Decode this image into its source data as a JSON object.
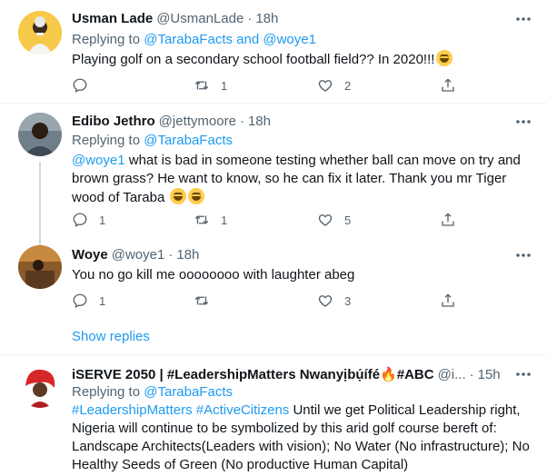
{
  "tweets": [
    {
      "name": "Usman Lade",
      "handle": "@UsmanLade",
      "dot": "·",
      "time": "18h",
      "replying_prefix": "Replying to",
      "replying_to_1": "@TarabaFacts",
      "replying_and": "and",
      "replying_to_2": "@woye1",
      "text": "Playing golf on a secondary school football field?? In 2020!!!",
      "emoji": "laughing-face",
      "reply_count": "",
      "retweet_count": "1",
      "like_count": "2"
    },
    {
      "name": "Edibo Jethro",
      "handle": "@jettymoore",
      "dot": "·",
      "time": "18h",
      "replying_prefix": "Replying to",
      "replying_to_1": "@TarabaFacts",
      "mention": "@woye1",
      "text": " what is bad in someone testing whether ball can move on try and brown grass? He want to know, so he can fix it later. Thank you mr Tiger wood of Taraba",
      "emoji": "grinning-face",
      "reply_count": "1",
      "retweet_count": "1",
      "like_count": "5"
    },
    {
      "name": "Woye",
      "handle": "@woye1",
      "dot": "·",
      "time": "18h",
      "text": "You no go kill me oooooooo with laughter abeg",
      "reply_count": "1",
      "retweet_count": "",
      "like_count": "3"
    },
    {
      "name": "iSERVE 2050 | #LeadershipMatters Nwanyịbụ́ífé🔥#ABC",
      "handle": "@i...",
      "dot": "·",
      "time": "15h",
      "replying_prefix": "Replying to",
      "replying_to_1": "@TarabaFacts",
      "hashtag_1": "#LeadershipMatters",
      "hashtag_2": "#ActiveCitizens",
      "text": " Until we get  Political Leadership right, Nigeria will continue to be symbolized by this arid golf course bereft of: Landscape Architects(Leaders with vision); No Water (No infrastructure); No Healthy Seeds of Green (No productive Human Capital)"
    }
  ],
  "show_replies": "Show replies",
  "colors": {
    "link": "#1d9bf0",
    "secondary": "#536471",
    "thread_line": "#cfd9de"
  }
}
